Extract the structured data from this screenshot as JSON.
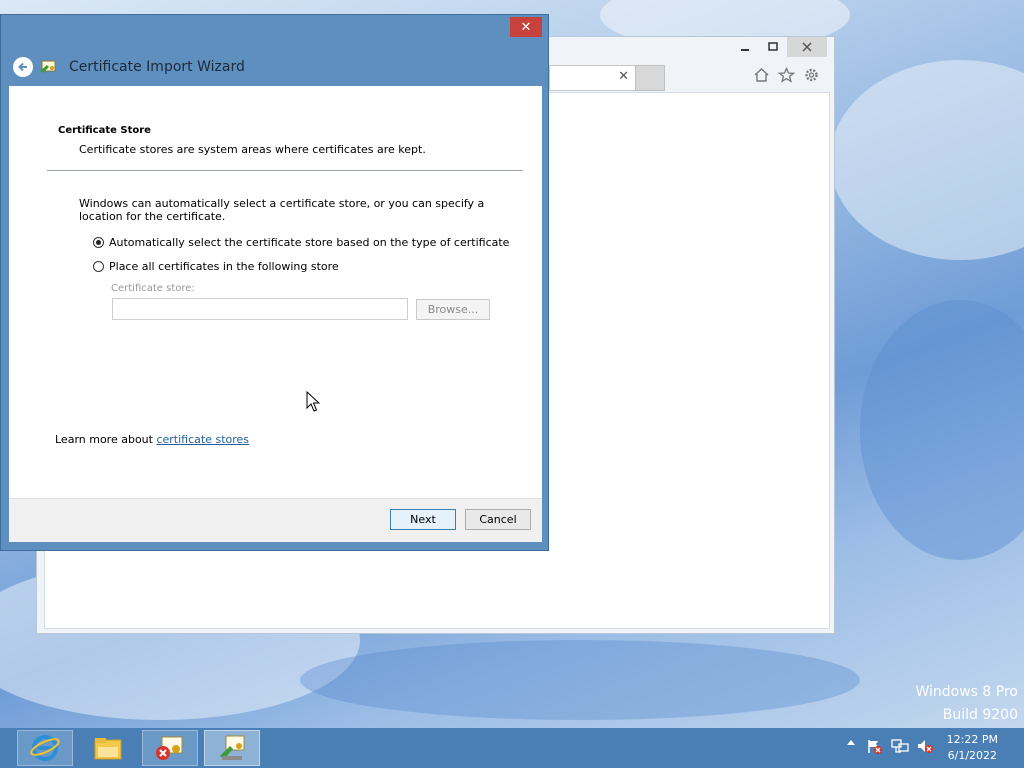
{
  "browser": {
    "minimize_icon": "minimize-icon",
    "maximize_icon": "maximize-icon",
    "close_icon": "close-icon",
    "toolbar_icons": [
      "home-icon",
      "favorites-star-icon",
      "settings-gear-icon"
    ]
  },
  "wizard": {
    "title": "Certificate Import Wizard",
    "close_glyph": "✕",
    "section_title": "Certificate Store",
    "section_desc": "Certificate stores are system areas where certificates are kept.",
    "intro_text": "Windows can automatically select a certificate store, or you can specify a location for the certificate.",
    "radio_auto": "Automatically select the certificate store based on the type of certificate",
    "radio_auto_checked": true,
    "radio_manual": "Place all certificates in the following store",
    "store_label": "Certificate store:",
    "store_value": "",
    "browse_label": "Browse...",
    "learn_prefix": "Learn more about ",
    "learn_link": "certificate stores",
    "next_label": "Next",
    "cancel_label": "Cancel"
  },
  "desktop": {
    "watermark_line1": "Windows 8 Pro",
    "watermark_line2": "Build 9200"
  },
  "taskbar": {
    "items": [
      {
        "name": "internet-explorer",
        "icon": "ie-icon"
      },
      {
        "name": "file-explorer",
        "icon": "folder-icon"
      },
      {
        "name": "certificate-manager",
        "icon": "certificate-icon"
      },
      {
        "name": "certificate-import-wizard",
        "icon": "cert-import-icon"
      }
    ],
    "time": "12:22 PM",
    "date": "6/1/2022"
  }
}
